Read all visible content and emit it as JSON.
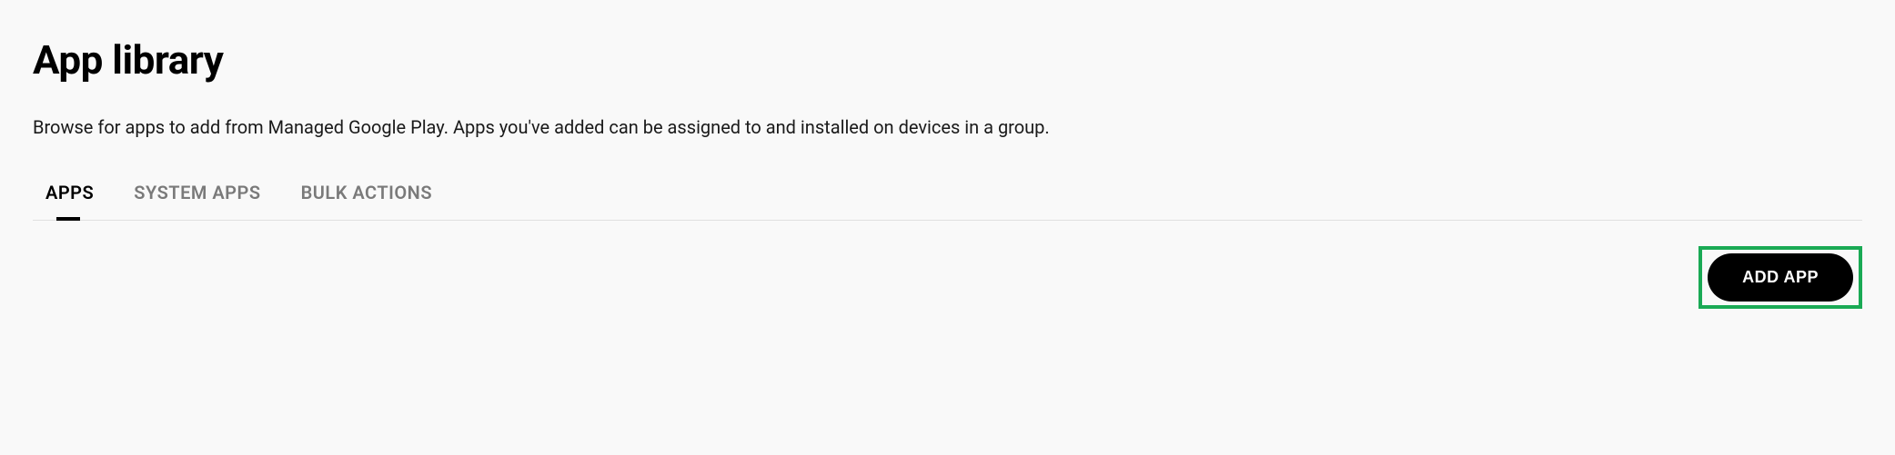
{
  "header": {
    "title": "App library",
    "description": "Browse for apps to add from Managed Google Play. Apps you've added can be assigned to and installed on devices in a group."
  },
  "tabs": [
    {
      "label": "APPS",
      "active": true
    },
    {
      "label": "SYSTEM APPS",
      "active": false
    },
    {
      "label": "BULK ACTIONS",
      "active": false
    }
  ],
  "actions": {
    "add_app_label": "ADD APP"
  },
  "colors": {
    "highlight": "#1aaa55",
    "button_bg": "#000000",
    "button_fg": "#ffffff"
  }
}
